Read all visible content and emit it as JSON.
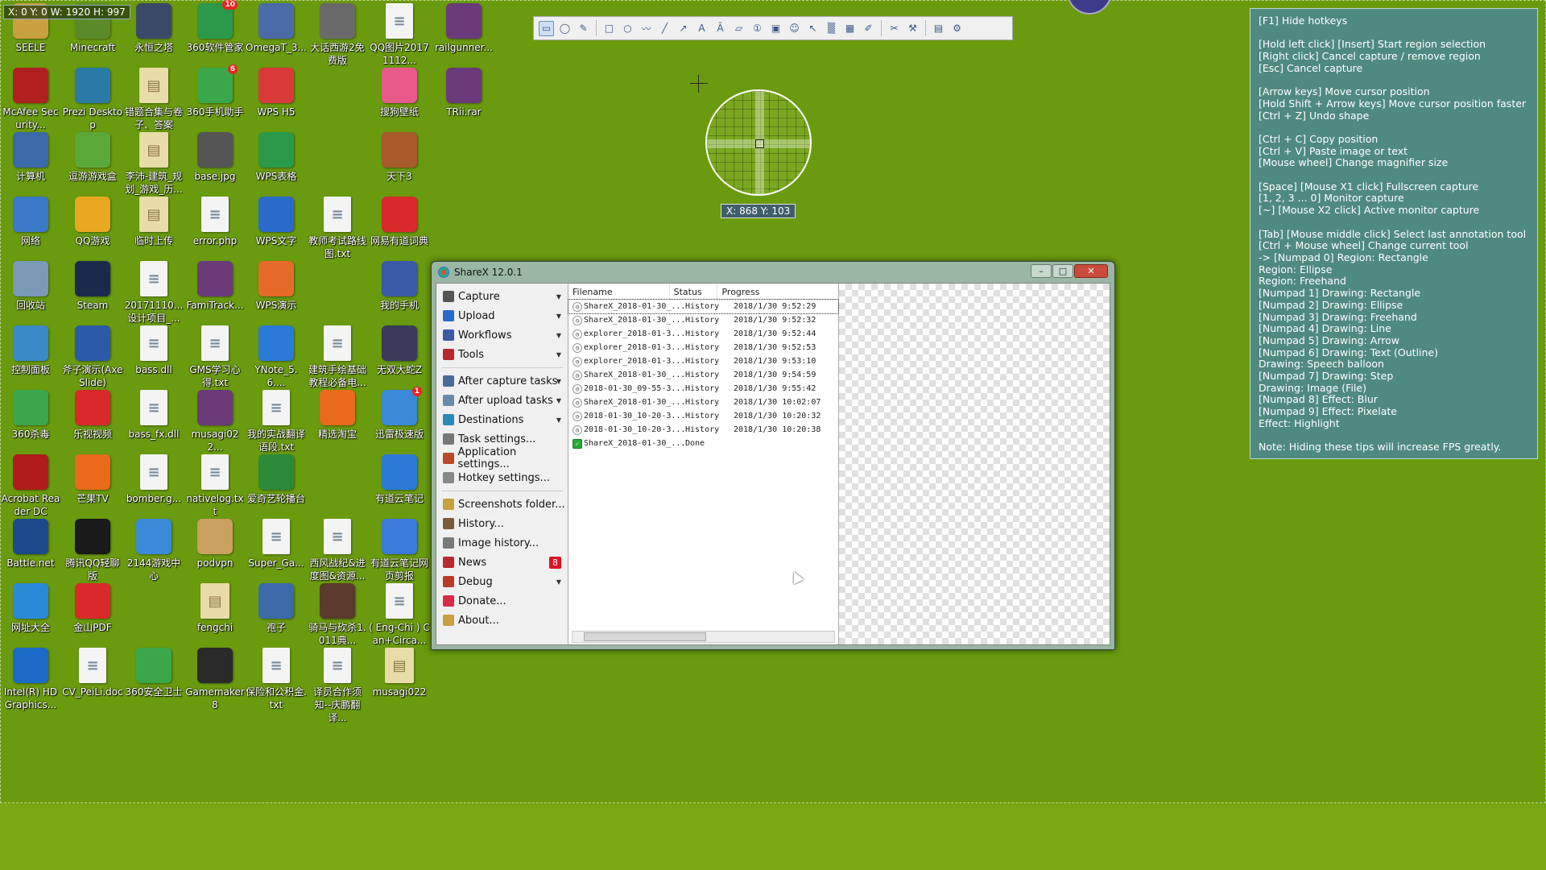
{
  "capture_overlay": {
    "region_dimensions": "X: 0 Y: 0 W: 1920 H: 997",
    "cursor_position": "X: 868 Y: 103"
  },
  "desktop_icons": [
    {
      "label": "SEELE",
      "icon": "app-icon",
      "color": "#c8a040",
      "type": "app",
      "col": 0,
      "row": 0
    },
    {
      "label": "Minecraft",
      "icon": "minecraft-icon",
      "color": "#5a8a2a",
      "type": "app",
      "col": 1,
      "row": 0
    },
    {
      "label": "永恒之塔",
      "icon": "game-icon",
      "color": "#384a68",
      "type": "app",
      "col": 2,
      "row": 0
    },
    {
      "label": "360软件管家",
      "icon": "360-icon",
      "color": "#2a9a4a",
      "type": "app",
      "col": 3,
      "row": 0
    },
    {
      "label": "OmegaT_3...",
      "icon": "omegat-icon",
      "color": "#4a6aa8",
      "type": "app",
      "col": 4,
      "row": 0
    },
    {
      "label": "大话西游2免费版",
      "icon": "game-icon",
      "color": "#6a6a6a",
      "type": "app",
      "col": 5,
      "row": 0
    },
    {
      "label": "QQ图片20171112...",
      "icon": "image-icon",
      "color": "#f4f4f4",
      "type": "doc",
      "col": 6,
      "row": 0
    },
    {
      "label": "railgunner...",
      "icon": "archive-icon",
      "color": "#6a3a7a",
      "type": "app",
      "col": 7,
      "row": 0
    },
    {
      "label": "McAfee Security...",
      "icon": "mcafee-icon",
      "color": "#b02020",
      "type": "app",
      "col": 0,
      "row": 1
    },
    {
      "label": "Prezi Desktop",
      "icon": "prezi-icon",
      "color": "#2a7aa8",
      "type": "app",
      "col": 1,
      "row": 1
    },
    {
      "label": "错题合集与卷子、答案",
      "icon": "folder-icon",
      "color": "#e8dca8",
      "type": "folder",
      "col": 2,
      "row": 1
    },
    {
      "label": "360手机助手",
      "icon": "360-phone-icon",
      "color": "#3aa84a",
      "type": "app",
      "col": 3,
      "row": 1
    },
    {
      "label": "WPS H5",
      "icon": "wps-h5-icon",
      "color": "#d83a3a",
      "type": "app",
      "col": 4,
      "row": 1
    },
    {
      "label": "搜狗壁纸",
      "icon": "sogou-icon",
      "color": "#e85a8a",
      "type": "app",
      "col": 6,
      "row": 1
    },
    {
      "label": "TRii.rar",
      "icon": "archive-icon",
      "color": "#6a3a7a",
      "type": "app",
      "col": 7,
      "row": 1
    },
    {
      "label": "计算机",
      "icon": "computer-icon",
      "color": "#3a6aa8",
      "type": "app",
      "col": 0,
      "row": 2
    },
    {
      "label": "逗游游戏盒",
      "icon": "game-box-icon",
      "color": "#5aa83a",
      "type": "app",
      "col": 1,
      "row": 2
    },
    {
      "label": "李沛-建筑_规划_游戏_历...",
      "icon": "folder-icon",
      "color": "#e8dca8",
      "type": "folder",
      "col": 2,
      "row": 2
    },
    {
      "label": "base.jpg",
      "icon": "image-icon",
      "color": "#555555",
      "type": "app",
      "col": 3,
      "row": 2
    },
    {
      "label": "WPS表格",
      "icon": "wps-sheet-icon",
      "color": "#2a9a4a",
      "type": "app",
      "col": 4,
      "row": 2
    },
    {
      "label": "天下3",
      "icon": "game-icon",
      "color": "#a85a2a",
      "type": "app",
      "col": 6,
      "row": 2
    },
    {
      "label": "网络",
      "icon": "network-icon",
      "color": "#3a7ac8",
      "type": "app",
      "col": 0,
      "row": 3
    },
    {
      "label": "QQ游戏",
      "icon": "qq-game-icon",
      "color": "#e8a820",
      "type": "app",
      "col": 1,
      "row": 3
    },
    {
      "label": "临时上传",
      "icon": "folder-icon",
      "color": "#e8dca8",
      "type": "folder",
      "col": 2,
      "row": 3
    },
    {
      "label": "error.php",
      "icon": "file-icon",
      "color": "#f4f4f4",
      "type": "doc",
      "col": 3,
      "row": 3
    },
    {
      "label": "WPS文字",
      "icon": "wps-writer-icon",
      "color": "#2a6ac8",
      "type": "app",
      "col": 4,
      "row": 3
    },
    {
      "label": "教师考试路线图.txt",
      "icon": "text-file-icon",
      "color": "#f4f4f4",
      "type": "doc",
      "col": 5,
      "row": 3
    },
    {
      "label": "网易有道词典",
      "icon": "youdao-icon",
      "color": "#d82a2a",
      "type": "app",
      "col": 6,
      "row": 3
    },
    {
      "label": "回收站",
      "icon": "recycle-bin-icon",
      "color": "#7a9ab8",
      "type": "app",
      "col": 0,
      "row": 4
    },
    {
      "label": "Steam",
      "icon": "steam-icon",
      "color": "#1a2a4a",
      "type": "app",
      "col": 1,
      "row": 4
    },
    {
      "label": "20171110...设计项目_...",
      "icon": "word-doc-icon",
      "color": "#f4f4f4",
      "type": "doc",
      "col": 2,
      "row": 4
    },
    {
      "label": "FamiTrack...",
      "icon": "archive-icon",
      "color": "#6a3a7a",
      "type": "app",
      "col": 3,
      "row": 4
    },
    {
      "label": "WPS演示",
      "icon": "wps-present-icon",
      "color": "#e86a2a",
      "type": "app",
      "col": 4,
      "row": 4
    },
    {
      "label": "我的手机",
      "icon": "phone-icon",
      "color": "#3a5aa8",
      "type": "app",
      "col": 6,
      "row": 4
    },
    {
      "label": "控制面板",
      "icon": "control-panel-icon",
      "color": "#3a8ac8",
      "type": "app",
      "col": 0,
      "row": 5
    },
    {
      "label": "斧子演示(AxeSlide)",
      "icon": "axeslide-icon",
      "color": "#2a5aa8",
      "type": "app",
      "col": 1,
      "row": 5
    },
    {
      "label": "bass.dll",
      "icon": "dll-file-icon",
      "color": "#f4f4f4",
      "type": "doc",
      "col": 2,
      "row": 5
    },
    {
      "label": "GMS学习心得.txt",
      "icon": "text-file-icon",
      "color": "#f4f4f4",
      "type": "doc",
      "col": 3,
      "row": 5
    },
    {
      "label": "YNote_5.6....",
      "icon": "ynote-icon",
      "color": "#2a7ad8",
      "type": "app",
      "col": 4,
      "row": 5
    },
    {
      "label": "建筑手绘基础教程必备电...",
      "icon": "pdf-icon",
      "color": "#f4f4f4",
      "type": "doc",
      "col": 5,
      "row": 5
    },
    {
      "label": "无双大蛇Z",
      "icon": "game-icon",
      "color": "#3a3a5a",
      "type": "app",
      "col": 6,
      "row": 5
    },
    {
      "label": "360杀毒",
      "icon": "360-antivirus-icon",
      "color": "#3aa84a",
      "type": "app",
      "col": 0,
      "row": 6
    },
    {
      "label": "乐视视频",
      "icon": "letv-icon",
      "color": "#d82a2a",
      "type": "app",
      "col": 1,
      "row": 6
    },
    {
      "label": "bass_fx.dll",
      "icon": "dll-file-icon",
      "color": "#f4f4f4",
      "type": "doc",
      "col": 2,
      "row": 6
    },
    {
      "label": "musagi022...",
      "icon": "archive-icon",
      "color": "#6a3a7a",
      "type": "app",
      "col": 3,
      "row": 6
    },
    {
      "label": "我的实战翻译语段.txt",
      "icon": "text-file-icon",
      "color": "#f4f4f4",
      "type": "doc",
      "col": 4,
      "row": 6
    },
    {
      "label": "精选淘宝",
      "icon": "taobao-icon",
      "color": "#e86a1a",
      "type": "app",
      "col": 5,
      "row": 6
    },
    {
      "label": "迅雷极速版",
      "icon": "thunder-icon",
      "color": "#3a8ad8",
      "type": "app",
      "col": 6,
      "row": 6
    },
    {
      "label": "Acrobat Reader DC",
      "icon": "acrobat-icon",
      "color": "#b01a1a",
      "type": "app",
      "col": 0,
      "row": 7
    },
    {
      "label": "芒果TV",
      "icon": "mango-tv-icon",
      "color": "#e86a1a",
      "type": "app",
      "col": 1,
      "row": 7
    },
    {
      "label": "bomber.g...",
      "icon": "file-icon",
      "color": "#f4f4f4",
      "type": "doc",
      "col": 2,
      "row": 7
    },
    {
      "label": "nativelog.txt",
      "icon": "text-file-icon",
      "color": "#f4f4f4",
      "type": "doc",
      "col": 3,
      "row": 7
    },
    {
      "label": "爱奇艺轮播台",
      "icon": "iqiyi-icon",
      "color": "#2a8a3a",
      "type": "app",
      "col": 4,
      "row": 7
    },
    {
      "label": "有道云笔记",
      "icon": "youdao-note-icon",
      "color": "#2a7ad8",
      "type": "app",
      "col": 6,
      "row": 7
    },
    {
      "label": "Battle.net",
      "icon": "battlenet-icon",
      "color": "#1a4a8a",
      "type": "app",
      "col": 0,
      "row": 8
    },
    {
      "label": "腾讯QQ轻聊版",
      "icon": "qq-icon",
      "color": "#1a1a1a",
      "type": "app",
      "col": 1,
      "row": 8
    },
    {
      "label": "2144游戏中心",
      "icon": "game-center-icon",
      "color": "#3a8ad8",
      "type": "app",
      "col": 2,
      "row": 8
    },
    {
      "label": "podvpn",
      "icon": "vpn-icon",
      "color": "#c8a060",
      "type": "app",
      "col": 3,
      "row": 8
    },
    {
      "label": "Super_Ga...",
      "icon": "dll-file-icon",
      "color": "#f4f4f4",
      "type": "doc",
      "col": 4,
      "row": 8
    },
    {
      "label": "西风战纪&进度图&资源...",
      "icon": "spreadsheet-icon",
      "color": "#f4f4f4",
      "type": "doc",
      "col": 5,
      "row": 8
    },
    {
      "label": "有道云笔记网页剪报",
      "icon": "web-clip-icon",
      "color": "#3a7ad8",
      "type": "app",
      "col": 6,
      "row": 8
    },
    {
      "label": "网址大全",
      "icon": "ie-icon",
      "color": "#2a8ad8",
      "type": "app",
      "col": 0,
      "row": 9
    },
    {
      "label": "金山PDF",
      "icon": "kingsoft-pdf-icon",
      "color": "#d82a2a",
      "type": "app",
      "col": 1,
      "row": 9
    },
    {
      "label": "fengchi",
      "icon": "folder-icon",
      "color": "#e8dca8",
      "type": "folder",
      "col": 3,
      "row": 9
    },
    {
      "label": "孢子",
      "icon": "spore-icon",
      "color": "#3a6aa8",
      "type": "app",
      "col": 4,
      "row": 9
    },
    {
      "label": "骑马与砍杀1.011典...",
      "icon": "game-icon",
      "color": "#5a3a2a",
      "type": "app",
      "col": 5,
      "row": 9
    },
    {
      "label": "( Eng-Chi ) Can+Circa...",
      "icon": "word-doc-icon",
      "color": "#f4f4f4",
      "type": "doc",
      "col": 6,
      "row": 9
    },
    {
      "label": "Intel(R) HD Graphics...",
      "icon": "intel-icon",
      "color": "#1a6ac8",
      "type": "app",
      "col": 0,
      "row": 10
    },
    {
      "label": "CV_PeiLi.doc",
      "icon": "word-doc-icon",
      "color": "#f4f4f4",
      "type": "doc",
      "col": 1,
      "row": 10
    },
    {
      "label": "360安全卫士",
      "icon": "360-guard-icon",
      "color": "#3aa84a",
      "type": "app",
      "col": 2,
      "row": 10
    },
    {
      "label": "Gamemaker 8",
      "icon": "gamemaker-icon",
      "color": "#2a2a2a",
      "type": "app",
      "col": 3,
      "row": 10
    },
    {
      "label": "保险和公积金.txt",
      "icon": "text-file-icon",
      "color": "#f4f4f4",
      "type": "doc",
      "col": 4,
      "row": 10
    },
    {
      "label": "译员合作须知--庆鹏翻译...",
      "icon": "word-doc-icon",
      "color": "#f4f4f4",
      "type": "doc",
      "col": 5,
      "row": 10
    },
    {
      "label": "musagi022",
      "icon": "folder-icon",
      "color": "#e8dca8",
      "type": "folder",
      "col": 6,
      "row": 10
    }
  ],
  "icon_badges": {
    "360软件管家": "10",
    "迅雷极速版": "1",
    "360手机助手": "6"
  },
  "toolbar": {
    "tools": [
      "region-rectangle-icon",
      "region-ellipse-icon",
      "region-freehand-icon",
      "sep",
      "rectangle-icon",
      "ellipse-icon",
      "freehand-icon",
      "line-icon",
      "arrow-icon",
      "text-outline-icon",
      "text-background-icon",
      "speech-balloon-icon",
      "step-icon",
      "image-icon",
      "sticker-icon",
      "cursor-icon",
      "blur-icon",
      "pixelate-icon",
      "highlight-icon",
      "sep",
      "edit-menu-icon",
      "tools-menu-icon",
      "sep",
      "capture-menu-icon",
      "settings-icon"
    ]
  },
  "sharex": {
    "title": "ShareX 12.0.1",
    "window_buttons": {
      "minimize": "–",
      "maximize": "□",
      "close": "✕"
    },
    "menu": [
      {
        "label": "Capture",
        "icon": "capture-icon",
        "color": "#555",
        "arrow": true
      },
      {
        "label": "Upload",
        "icon": "upload-icon",
        "color": "#2a6ac8",
        "arrow": true
      },
      {
        "label": "Workflows",
        "icon": "workflows-icon",
        "color": "#3a5aa8",
        "arrow": true
      },
      {
        "label": "Tools",
        "icon": "tools-icon",
        "color": "#b82a2a",
        "arrow": true
      },
      {
        "sep": true
      },
      {
        "label": "After capture tasks",
        "icon": "after-capture-icon",
        "color": "#4a6a9a",
        "arrow": true
      },
      {
        "label": "After upload tasks",
        "icon": "after-upload-icon",
        "color": "#6a8aaa",
        "arrow": true
      },
      {
        "label": "Destinations",
        "icon": "destinations-icon",
        "color": "#2a8ab8",
        "arrow": true
      },
      {
        "label": "Task settings...",
        "icon": "task-settings-icon",
        "color": "#777"
      },
      {
        "label": "Application settings...",
        "icon": "application-settings-icon",
        "color": "#b84a2a"
      },
      {
        "label": "Hotkey settings...",
        "icon": "hotkey-settings-icon",
        "color": "#888"
      },
      {
        "sep": true
      },
      {
        "label": "Screenshots folder...",
        "icon": "screenshots-folder-icon",
        "color": "#c8a040"
      },
      {
        "label": "History...",
        "icon": "history-icon",
        "color": "#7a5a3a"
      },
      {
        "label": "Image history...",
        "icon": "image-history-icon",
        "color": "#7a7a7a"
      },
      {
        "label": "News",
        "icon": "news-icon",
        "color": "#b82a2a",
        "badge": "8"
      },
      {
        "label": "Debug",
        "icon": "debug-icon",
        "color": "#b83a2a",
        "arrow": true
      },
      {
        "label": "Donate...",
        "icon": "donate-icon",
        "color": "#d82a4a"
      },
      {
        "label": "About...",
        "icon": "about-icon",
        "color": "#c8a040"
      }
    ],
    "columns": [
      "Filename",
      "Status",
      "Progress"
    ],
    "rows": [
      {
        "filename": "ShareX_2018-01-30_...",
        "status": "History",
        "progress": "2018/1/30 9:52:29",
        "done": false
      },
      {
        "filename": "ShareX_2018-01-30_...",
        "status": "History",
        "progress": "2018/1/30 9:52:32",
        "done": false
      },
      {
        "filename": "explorer_2018-01-3...",
        "status": "History",
        "progress": "2018/1/30 9:52:44",
        "done": false
      },
      {
        "filename": "explorer_2018-01-3...",
        "status": "History",
        "progress": "2018/1/30 9:52:53",
        "done": false
      },
      {
        "filename": "explorer_2018-01-3...",
        "status": "History",
        "progress": "2018/1/30 9:53:10",
        "done": false
      },
      {
        "filename": "ShareX_2018-01-30_...",
        "status": "History",
        "progress": "2018/1/30 9:54:59",
        "done": false
      },
      {
        "filename": "2018-01-30_09-55-3...",
        "status": "History",
        "progress": "2018/1/30 9:55:42",
        "done": false
      },
      {
        "filename": "ShareX_2018-01-30_...",
        "status": "History",
        "progress": "2018/1/30 10:02:07",
        "done": false
      },
      {
        "filename": "2018-01-30_10-20-3...",
        "status": "History",
        "progress": "2018/1/30 10:20:32",
        "done": false
      },
      {
        "filename": "2018-01-30_10-20-3...",
        "status": "History",
        "progress": "2018/1/30 10:20:38",
        "done": false
      },
      {
        "filename": "ShareX_2018-01-30_...",
        "status": "Done",
        "progress": "",
        "done": true
      }
    ]
  },
  "hotkeys": {
    "lines": [
      "[F1] Hide hotkeys",
      "",
      "[Hold left click] [Insert] Start region selection",
      "[Right click] Cancel capture / remove region",
      "[Esc] Cancel capture",
      "",
      "[Arrow keys] Move cursor position",
      "[Hold Shift + Arrow keys] Move cursor position faster",
      "[Ctrl + Z] Undo shape",
      "",
      "[Ctrl + C] Copy position",
      "[Ctrl + V] Paste image or text",
      "[Mouse wheel] Change magnifier size",
      "",
      "[Space] [Mouse X1 click] Fullscreen capture",
      "[1, 2, 3 ... 0] Monitor capture",
      "[~] [Mouse X2 click] Active monitor capture",
      "",
      "[Tab] [Mouse middle click] Select last annotation tool",
      "[Ctrl + Mouse wheel] Change current tool",
      "-> [Numpad 0] Region: Rectangle",
      "Region: Ellipse",
      "Region: Freehand",
      "[Numpad 1] Drawing: Rectangle",
      "[Numpad 2] Drawing: Ellipse",
      "[Numpad 3] Drawing: Freehand",
      "[Numpad 4] Drawing: Line",
      "[Numpad 5] Drawing: Arrow",
      "[Numpad 6] Drawing: Text (Outline)",
      "Drawing: Speech balloon",
      "[Numpad 7] Drawing: Step",
      "Drawing: Image (File)",
      "[Numpad 8] Effect: Blur",
      "[Numpad 9] Effect: Pixelate",
      "Effect: Highlight",
      "",
      "Note: Hiding these tips will increase FPS greatly."
    ]
  }
}
